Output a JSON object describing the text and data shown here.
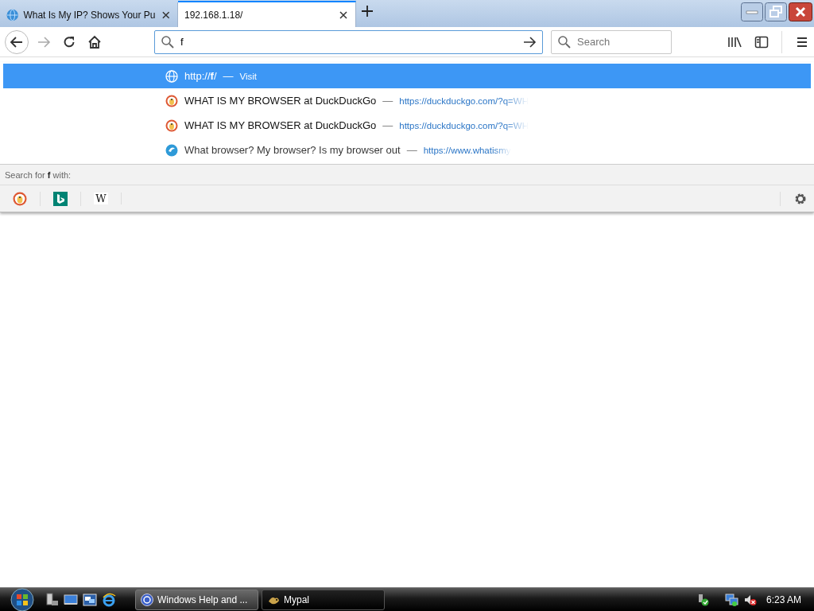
{
  "tabs": [
    {
      "title": "What Is My IP? Shows Your Pu",
      "selected": false,
      "kind": "site"
    },
    {
      "title": "192.168.1.18/",
      "selected": true,
      "kind": "blank"
    }
  ],
  "address_bar": {
    "value": "f"
  },
  "search": {
    "placeholder": "Search"
  },
  "results": [
    {
      "kind": "visit",
      "title": "http://**f**/",
      "separator": "—",
      "action": "Visit",
      "selected": true
    },
    {
      "kind": "duckduckgo",
      "title": "WHAT IS MY BROWSER at DuckDuckGo",
      "separator": "—",
      "url": "https://duckduckgo.com/?q=WH",
      "selected": false
    },
    {
      "kind": "duckduckgo",
      "title": "WHAT IS MY BROWSER at DuckDuckGo",
      "separator": "—",
      "url": "https://duckduckgo.com/?q=WH",
      "selected": false
    },
    {
      "kind": "site",
      "title": "What browser? My browser? Is my browser out",
      "separator": "—",
      "url": "https://www.whatismy",
      "selected": false
    }
  ],
  "search_with": "Search for **f** with:",
  "engines": [
    {
      "kind": "duckduckgo"
    },
    {
      "kind": "bing"
    },
    {
      "kind": "wikipedia",
      "label": "W"
    }
  ],
  "taskbar": {
    "buttons": [
      {
        "label": "Windows Help and ...",
        "kind": "help",
        "selected": false
      },
      {
        "label": "Mypal",
        "kind": "mypal",
        "selected": true
      }
    ],
    "clock": "6:23 AM"
  }
}
